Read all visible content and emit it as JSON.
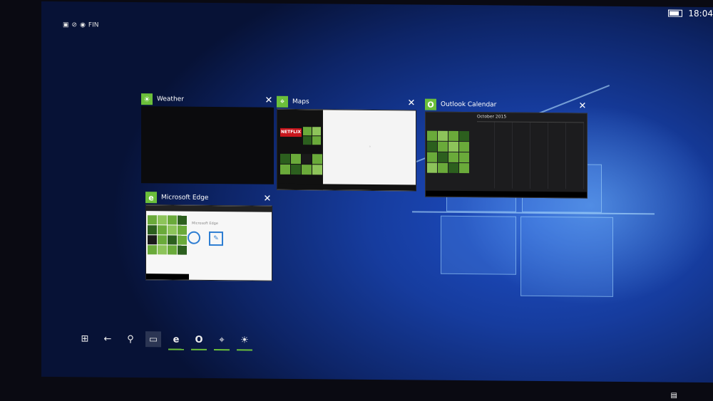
{
  "status_bar": {
    "left_text": "FIN",
    "time": "18:04"
  },
  "windows": [
    {
      "key": "weather",
      "title": "Weather",
      "icon": "sun-icon",
      "accent": "#6bbf3a"
    },
    {
      "key": "maps",
      "title": "Maps",
      "icon": "map-pin-icon",
      "accent": "#6bbf3a"
    },
    {
      "key": "outlook",
      "title": "Outlook Calendar",
      "icon": "outlook-icon",
      "accent": "#6bbf3a"
    },
    {
      "key": "edge",
      "title": "Microsoft Edge",
      "icon": "edge-icon",
      "accent": "#6bbf3a"
    }
  ],
  "maps_thumb": {
    "brand": "NETFLIX"
  },
  "outlook_thumb": {
    "month": "October 2015"
  },
  "edge_thumb": {
    "page_title": "Microsoft Edge"
  },
  "taskbar": {
    "icons": [
      "start-icon",
      "back-icon",
      "search-icon",
      "task-view-icon",
      "edge-icon",
      "outlook-icon",
      "maps-icon",
      "weather-icon"
    ]
  },
  "colors": {
    "accent": "#6bbf3a",
    "desktop": "#163c9e"
  }
}
